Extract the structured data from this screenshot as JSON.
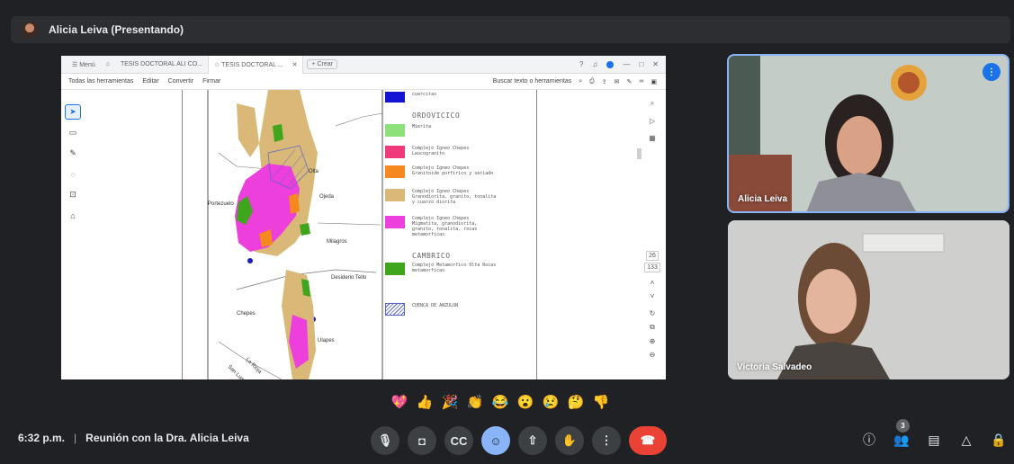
{
  "meet": {
    "presenter_bar": {
      "title": "Alicia Leiva (Presentando)"
    },
    "time": "6:32 p.m.",
    "meeting_title": "Reunión con la Dra. Alicia Leiva",
    "participants_count": "3",
    "controls": [
      "mic-icon",
      "camera-icon",
      "captions-icon",
      "emoji-icon",
      "present-icon",
      "raise-hand-icon",
      "more-options-icon",
      "end-call-icon"
    ],
    "right_controls": [
      "info-icon",
      "people-icon",
      "chat-icon",
      "activities-icon",
      "host-controls-icon"
    ],
    "reactions": [
      "💖",
      "👍",
      "🎉",
      "👏",
      "😂",
      "😮",
      "😢",
      "🤔",
      "👎"
    ]
  },
  "participants": [
    {
      "name": "Alicia Leiva",
      "speaking": true
    },
    {
      "name": "Victoria Salvadeo",
      "speaking": false
    }
  ],
  "shared_app": {
    "tabs": [
      {
        "label": "☰ Menú"
      },
      {
        "label": "⌂"
      },
      {
        "label": "TESIS DOCTORAL ALI CO..."
      },
      {
        "label": "☆ TESIS DOCTORAL ..."
      }
    ],
    "new_tab": "+ Crear",
    "menu": [
      "Todas las herramientas",
      "Editar",
      "Convertir",
      "Firmar"
    ],
    "search_label": "Buscar texto o herramientas",
    "page_numbers": [
      "26",
      "133"
    ]
  },
  "map": {
    "place_labels": [
      "Olta",
      "Portezuelo",
      "Ojeda",
      "Milagros",
      "Desiderio Tello",
      "Chepes",
      "Ulapes",
      "La Rioja",
      "San Luis"
    ]
  },
  "legend": {
    "top_text": "cuarcitas",
    "section_ordovicico": "ORDOVICICO",
    "section_cambrico": "CAMBRICO",
    "items": [
      {
        "label": "Mierita",
        "color": "#8ee07a"
      },
      {
        "label": "Complejo Igneo Chepes Leucogranito",
        "color": "#ee3a7a"
      },
      {
        "label": "Complejo Igneo Chepes Granitoide porfirico y seriado",
        "color": "#f5891f"
      },
      {
        "label": "Complejo Igneo Chepes Granodiorita, granito, tonalita y cuarzo diorita",
        "color": "#d9b878"
      },
      {
        "label": "Complejo Igneo Chepes Migmatita, granodiorita, granito, tonalita, rocas metamorficas",
        "color": "#ec3fdc"
      },
      {
        "label": "Complejo Metamorfico Olta Rocas metamorficas",
        "color": "#3fa51d"
      },
      {
        "label": "CUENCA DE ANZULON",
        "color": "#ffffff"
      }
    ]
  },
  "colors": {
    "background": "#202124",
    "accent": "#8ab4f8",
    "end_call": "#ea4335"
  }
}
